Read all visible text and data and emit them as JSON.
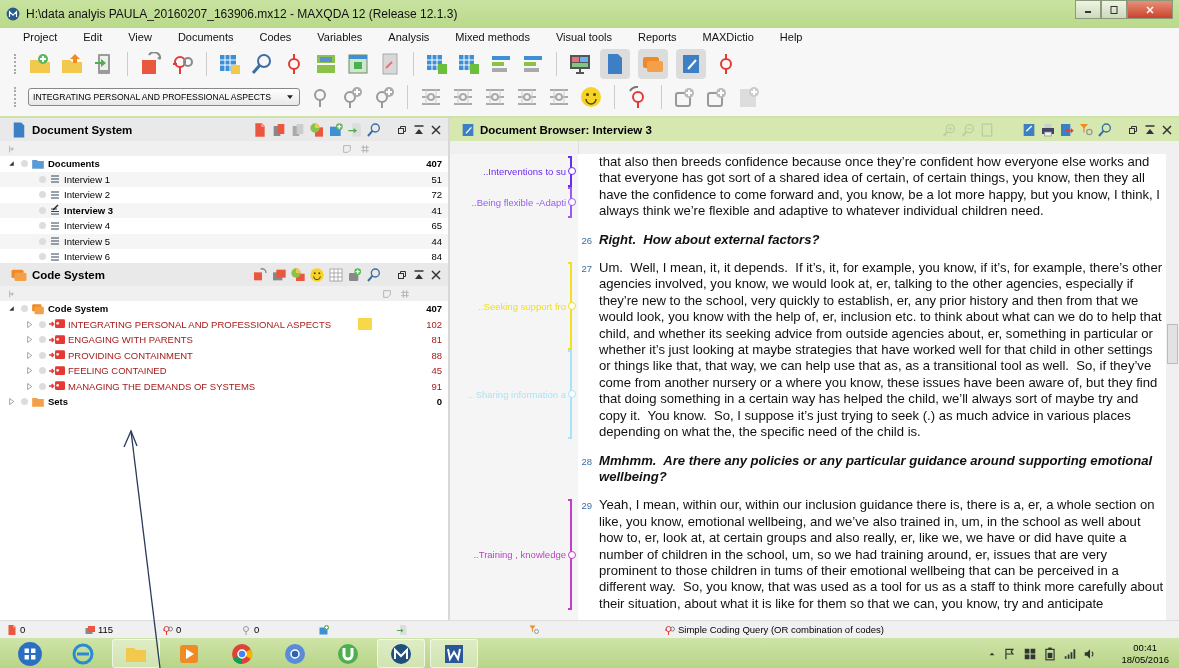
{
  "window": {
    "title": "H:\\data analyis PAULA_20160207_163906.mx12 - MAXQDA 12  (Release 12.1.3)"
  },
  "menu": [
    "Project",
    "Edit",
    "View",
    "Documents",
    "Codes",
    "Variables",
    "Analysis",
    "Mixed methods",
    "Visual tools",
    "Reports",
    "MAXDictio",
    "Help"
  ],
  "code_dropdown": {
    "value": "INTEGRATING PERSONAL AND PROFESSIONAL ASPECTS"
  },
  "document_system": {
    "title": "Document System",
    "tree": [
      {
        "label": "Documents",
        "kind": "folder",
        "count": "407",
        "expanded": true,
        "children": [
          {
            "label": "Interview 1",
            "kind": "document",
            "count": "51",
            "selected": false
          },
          {
            "label": "Interview 2",
            "kind": "document",
            "count": "72",
            "selected": false
          },
          {
            "label": "Interview 3",
            "kind": "document",
            "count": "41",
            "selected": true
          },
          {
            "label": "Interview 4",
            "kind": "document",
            "count": "65",
            "selected": false
          },
          {
            "label": "Interview 5",
            "kind": "document",
            "count": "44",
            "selected": false
          },
          {
            "label": "Interview 6",
            "kind": "document",
            "count": "84",
            "selected": false
          }
        ]
      }
    ]
  },
  "code_system": {
    "title": "Code System",
    "tree": [
      {
        "label": "Code System",
        "kind": "code-root",
        "count": "407",
        "expanded": true,
        "children": [
          {
            "label": "INTEGRATING PERSONAL AND PROFESSIONAL ASPECTS",
            "kind": "code",
            "count": "102",
            "expanded": false,
            "memo": true
          },
          {
            "label": "ENGAGING WITH PARENTS",
            "kind": "code",
            "count": "81",
            "expanded": false,
            "memo": false
          },
          {
            "label": "PROVIDING CONTAINMENT",
            "kind": "code",
            "count": "88",
            "expanded": false,
            "memo": false
          },
          {
            "label": "FEELING CONTAINED",
            "kind": "code",
            "count": "45",
            "expanded": false,
            "memo": false
          },
          {
            "label": "MANAGING THE DEMANDS OF SYSTEMS",
            "kind": "code",
            "count": "91",
            "expanded": false,
            "memo": false
          }
        ]
      },
      {
        "label": "Sets",
        "kind": "set",
        "count": "0",
        "expanded": false
      }
    ]
  },
  "document_browser": {
    "title": "Document Browser: Interview 3",
    "paragraphs": [
      {
        "kind": "answer",
        "text": "that also then breeds confidence because once they’re confident how everyone else works and that everyone has got sort of a shared idea of certain, of certain things, you know, then they all have the confidence to come forward and, you know, be a lot more happy, but you know, I think, I always think we’re flexible and adaptive to whatever individual children need.",
        "codes": [
          {
            "label": "..Interventions to su",
            "color": "#6a2cf0"
          },
          {
            "label": "..Being flexible -Adapti",
            "color": "#9a5cf0"
          }
        ]
      },
      {
        "number": "26",
        "kind": "question",
        "text": "Right.  How about external factors?"
      },
      {
        "number": "27",
        "kind": "answer",
        "text": "Um.  Well, I mean, it, it depends.  If it’s, it, for example, you know, if it’s, for example, there’s other agencies involved, you know, we would look at, er, talking to the other agencies, especially if they’re new to the school, very quickly to establish, er, any prior history and then from that we would look, you know with the help of, er, inclusion etc. to think about what can we do to help that child, and whether its seeking advice from outside agencies about, er, something in particular or whether it’s just looking at maybe strategies that have worked well for that child in other settings or things like that, that way, we can help use that as, as a transitional tool as well.  So, if they’ve come from another nursery or a where you know, these issues have been aware of, but they find that doing something in a certain way has helped the child, we’ll always sort of maybe try and copy it.  You know.  So, I suppose it’s just trying to seek (.) as much advice in various places depending on what the, the specific need of the child is.",
        "codes": [
          {
            "label": "..Seeking support fro",
            "color": "#f0e020"
          },
          {
            "label": ".. Sharing information a",
            "color": "#a8e4f8"
          }
        ]
      },
      {
        "number": "28",
        "kind": "question",
        "text": "Mmhmm.  Are there any policies or any particular guidance around supporting emotional wellbeing?"
      },
      {
        "number": "29",
        "kind": "answer",
        "text": "Yeah, I mean, within our, within our inclusion guidance there is, there is a, er, a whole section on like, you know, emotional wellbeing, and we’ve also trained in, um, in the school as well about how to, er, look at, at certain groups and also really, er, like we, we have or did have quite a number of children in the school, um, so we had training around, er, issues that are very prominent to those children in tums of their emotional wellbeing that can be perceived in a different way.  So, you know, that was used as a tool for us as a staff to think more carefully about their situation, about what it is like for them so that we can, you know, try and anticipate",
        "codes": [
          {
            "label": "..Training , knowledge",
            "color": "#c040c8"
          }
        ]
      }
    ]
  },
  "status_bar": {
    "counts": [
      "0",
      "115",
      "0",
      "0"
    ],
    "query": "Simple Coding Query (OR combination of codes)"
  },
  "taskbar": {
    "time": "00:41",
    "date": "18/05/2016"
  }
}
